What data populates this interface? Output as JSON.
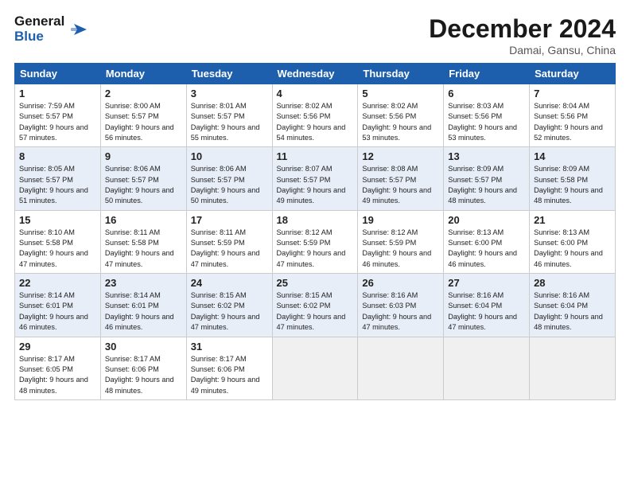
{
  "header": {
    "logo_general": "General",
    "logo_blue": "Blue",
    "month_title": "December 2024",
    "location": "Damai, Gansu, China"
  },
  "days_of_week": [
    "Sunday",
    "Monday",
    "Tuesday",
    "Wednesday",
    "Thursday",
    "Friday",
    "Saturday"
  ],
  "weeks": [
    [
      {
        "day": 1,
        "sunrise": "7:59 AM",
        "sunset": "5:57 PM",
        "daylight": "9 hours and 57 minutes."
      },
      {
        "day": 2,
        "sunrise": "8:00 AM",
        "sunset": "5:57 PM",
        "daylight": "9 hours and 56 minutes."
      },
      {
        "day": 3,
        "sunrise": "8:01 AM",
        "sunset": "5:57 PM",
        "daylight": "9 hours and 55 minutes."
      },
      {
        "day": 4,
        "sunrise": "8:02 AM",
        "sunset": "5:56 PM",
        "daylight": "9 hours and 54 minutes."
      },
      {
        "day": 5,
        "sunrise": "8:02 AM",
        "sunset": "5:56 PM",
        "daylight": "9 hours and 53 minutes."
      },
      {
        "day": 6,
        "sunrise": "8:03 AM",
        "sunset": "5:56 PM",
        "daylight": "9 hours and 53 minutes."
      },
      {
        "day": 7,
        "sunrise": "8:04 AM",
        "sunset": "5:56 PM",
        "daylight": "9 hours and 52 minutes."
      }
    ],
    [
      {
        "day": 8,
        "sunrise": "8:05 AM",
        "sunset": "5:57 PM",
        "daylight": "9 hours and 51 minutes."
      },
      {
        "day": 9,
        "sunrise": "8:06 AM",
        "sunset": "5:57 PM",
        "daylight": "9 hours and 50 minutes."
      },
      {
        "day": 10,
        "sunrise": "8:06 AM",
        "sunset": "5:57 PM",
        "daylight": "9 hours and 50 minutes."
      },
      {
        "day": 11,
        "sunrise": "8:07 AM",
        "sunset": "5:57 PM",
        "daylight": "9 hours and 49 minutes."
      },
      {
        "day": 12,
        "sunrise": "8:08 AM",
        "sunset": "5:57 PM",
        "daylight": "9 hours and 49 minutes."
      },
      {
        "day": 13,
        "sunrise": "8:09 AM",
        "sunset": "5:57 PM",
        "daylight": "9 hours and 48 minutes."
      },
      {
        "day": 14,
        "sunrise": "8:09 AM",
        "sunset": "5:58 PM",
        "daylight": "9 hours and 48 minutes."
      }
    ],
    [
      {
        "day": 15,
        "sunrise": "8:10 AM",
        "sunset": "5:58 PM",
        "daylight": "9 hours and 47 minutes."
      },
      {
        "day": 16,
        "sunrise": "8:11 AM",
        "sunset": "5:58 PM",
        "daylight": "9 hours and 47 minutes."
      },
      {
        "day": 17,
        "sunrise": "8:11 AM",
        "sunset": "5:59 PM",
        "daylight": "9 hours and 47 minutes."
      },
      {
        "day": 18,
        "sunrise": "8:12 AM",
        "sunset": "5:59 PM",
        "daylight": "9 hours and 47 minutes."
      },
      {
        "day": 19,
        "sunrise": "8:12 AM",
        "sunset": "5:59 PM",
        "daylight": "9 hours and 46 minutes."
      },
      {
        "day": 20,
        "sunrise": "8:13 AM",
        "sunset": "6:00 PM",
        "daylight": "9 hours and 46 minutes."
      },
      {
        "day": 21,
        "sunrise": "8:13 AM",
        "sunset": "6:00 PM",
        "daylight": "9 hours and 46 minutes."
      }
    ],
    [
      {
        "day": 22,
        "sunrise": "8:14 AM",
        "sunset": "6:01 PM",
        "daylight": "9 hours and 46 minutes."
      },
      {
        "day": 23,
        "sunrise": "8:14 AM",
        "sunset": "6:01 PM",
        "daylight": "9 hours and 46 minutes."
      },
      {
        "day": 24,
        "sunrise": "8:15 AM",
        "sunset": "6:02 PM",
        "daylight": "9 hours and 47 minutes."
      },
      {
        "day": 25,
        "sunrise": "8:15 AM",
        "sunset": "6:02 PM",
        "daylight": "9 hours and 47 minutes."
      },
      {
        "day": 26,
        "sunrise": "8:16 AM",
        "sunset": "6:03 PM",
        "daylight": "9 hours and 47 minutes."
      },
      {
        "day": 27,
        "sunrise": "8:16 AM",
        "sunset": "6:04 PM",
        "daylight": "9 hours and 47 minutes."
      },
      {
        "day": 28,
        "sunrise": "8:16 AM",
        "sunset": "6:04 PM",
        "daylight": "9 hours and 48 minutes."
      }
    ],
    [
      {
        "day": 29,
        "sunrise": "8:17 AM",
        "sunset": "6:05 PM",
        "daylight": "9 hours and 48 minutes."
      },
      {
        "day": 30,
        "sunrise": "8:17 AM",
        "sunset": "6:06 PM",
        "daylight": "9 hours and 48 minutes."
      },
      {
        "day": 31,
        "sunrise": "8:17 AM",
        "sunset": "6:06 PM",
        "daylight": "9 hours and 49 minutes."
      },
      null,
      null,
      null,
      null
    ]
  ]
}
